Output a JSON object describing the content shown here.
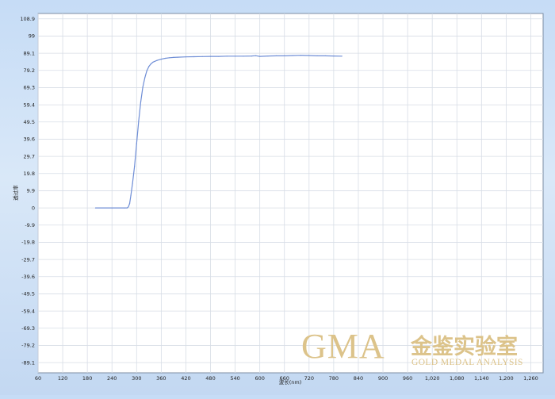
{
  "chart_data": {
    "type": "line",
    "title": "",
    "xlabel": "波长(nm)",
    "ylabel": "透过率",
    "xlim": [
      60,
      1290
    ],
    "ylim": [
      -95,
      112
    ],
    "x_ticks": [
      60,
      120,
      180,
      240,
      300,
      360,
      420,
      480,
      540,
      600,
      660,
      720,
      780,
      840,
      900,
      960,
      1020,
      1080,
      1140,
      1200,
      1260
    ],
    "x_tick_labels": [
      "60",
      "120",
      "180",
      "240",
      "300",
      "360",
      "420",
      "480",
      "540",
      "600",
      "660",
      "720",
      "780",
      "840",
      "900",
      "960",
      "1,020",
      "1,080",
      "1,140",
      "1,200",
      "1,260"
    ],
    "y_ticks": [
      108.9,
      99,
      89.1,
      79.2,
      69.3,
      59.4,
      49.5,
      39.6,
      29.7,
      19.8,
      9.9,
      0,
      -9.9,
      -19.8,
      -29.7,
      -39.6,
      -49.5,
      -59.4,
      -69.3,
      -79.2,
      -89.1
    ],
    "y_tick_labels": [
      "108.9",
      "99",
      "89.1",
      "79.2",
      "69.3",
      "59.4",
      "49.5",
      "39.6",
      "29.7",
      "19.8",
      "9.9",
      "0",
      "-9.9",
      "-19.8",
      "-29.7",
      "-39.6",
      "-49.5",
      "-59.4",
      "-69.3",
      "-79.2",
      "-89.1"
    ],
    "grid": true,
    "series": [
      {
        "color": "#6f8ed6",
        "x": [
          200,
          240,
          270,
          277,
          280,
          283,
          286,
          290,
          295,
          300,
          305,
          310,
          315,
          320,
          325,
          330,
          335,
          340,
          350,
          360,
          370,
          380,
          390,
          400,
          420,
          440,
          460,
          480,
          500,
          520,
          540,
          560,
          580,
          590,
          600,
          620,
          640,
          660,
          680,
          700,
          720,
          740,
          760,
          780,
          800
        ],
        "y": [
          0.0,
          0.0,
          0.0,
          0.0,
          0.6,
          2.5,
          7,
          14,
          24,
          37,
          50,
          61,
          69.5,
          75,
          79,
          81.5,
          83,
          84,
          85,
          85.7,
          86.2,
          86.5,
          86.7,
          86.8,
          87.0,
          87.1,
          87.2,
          87.3,
          87.3,
          87.4,
          87.4,
          87.4,
          87.5,
          87.7,
          87.3,
          87.5,
          87.6,
          87.6,
          87.8,
          87.9,
          87.8,
          87.6,
          87.6,
          87.5,
          87.4
        ]
      }
    ]
  },
  "watermark": {
    "logo": "GMA",
    "cn": "金鉴实验室",
    "en": "GOLD MEDAL ANALYSIS",
    "color": "#dcc38a"
  }
}
